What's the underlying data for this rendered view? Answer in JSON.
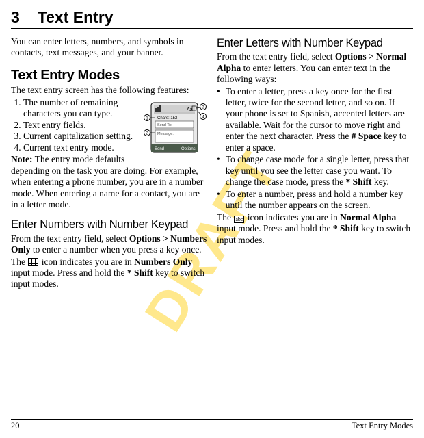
{
  "chapter_number": "3",
  "chapter_title": "Text Entry",
  "left": {
    "intro": "You can enter letters, numbers, and symbols in contacts, text messages, and your banner.",
    "h1": "Text Entry Modes",
    "p1": "The text entry screen has the following features:",
    "ol1": "The number of remaining characters you can type.",
    "ol2": "Text entry fields.",
    "ol3": "Current capitalization setting.",
    "ol4": "Current text entry mode.",
    "note_label": "Note:",
    "note_body": " The entry mode defaults depending on the task you are doing. For example, when entering a phone number, you are in a number mode. When entering a name for a contact, you are in a letter mode.",
    "h2": "Enter Numbers with Number Keypad",
    "p2a": "From the text entry field, select ",
    "p2b_bold": "Options > Numbers Only",
    "p2c": " to enter a number when you press a key once.",
    "p3a": "The ",
    "p3b": " icon indicates you are in ",
    "p3c_bold": "Numbers Only",
    "p3d": " input mode. Press and hold the ",
    "p3e_bold": "* Shift",
    "p3f": " key to switch input modes.",
    "fig": {
      "chars_label": "Chars: 152",
      "sendto": "Send To:",
      "msg": "Message:",
      "lsk": "Send",
      "rsk": "Options"
    }
  },
  "right": {
    "h2": "Enter Letters with Number Keypad",
    "p1a": "From the text entry field, select ",
    "p1b_bold": "Options > Normal Alpha",
    "p1c": " to enter letters. You can enter text in the following ways:",
    "li1a": "To enter a letter, press a key once for the first letter, twice for the second letter, and so on. If your phone is set to Spanish, accented letters are available. Wait for the cursor to move right and enter the next character. Press the ",
    "li1b_bold": "# Space",
    "li1c": " key to enter a space.",
    "li2a": "To change case mode for a single letter, press that key until you see the letter case you want. To change the case mode, press the ",
    "li2b_bold": "* Shift",
    "li2c": " key.",
    "li3": "To enter a number, press and hold a number key until the number appears on the screen.",
    "p2a": "The ",
    "p2b": " icon indicates you are in ",
    "p2c_bold": "Normal Alpha",
    "p2d": " input mode. Press and hold the ",
    "p2e_bold": "* Shift",
    "p2f": " key to switch input modes."
  },
  "footer": {
    "page": "20",
    "section": "Text Entry Modes"
  },
  "icon_abc_text": "abc"
}
